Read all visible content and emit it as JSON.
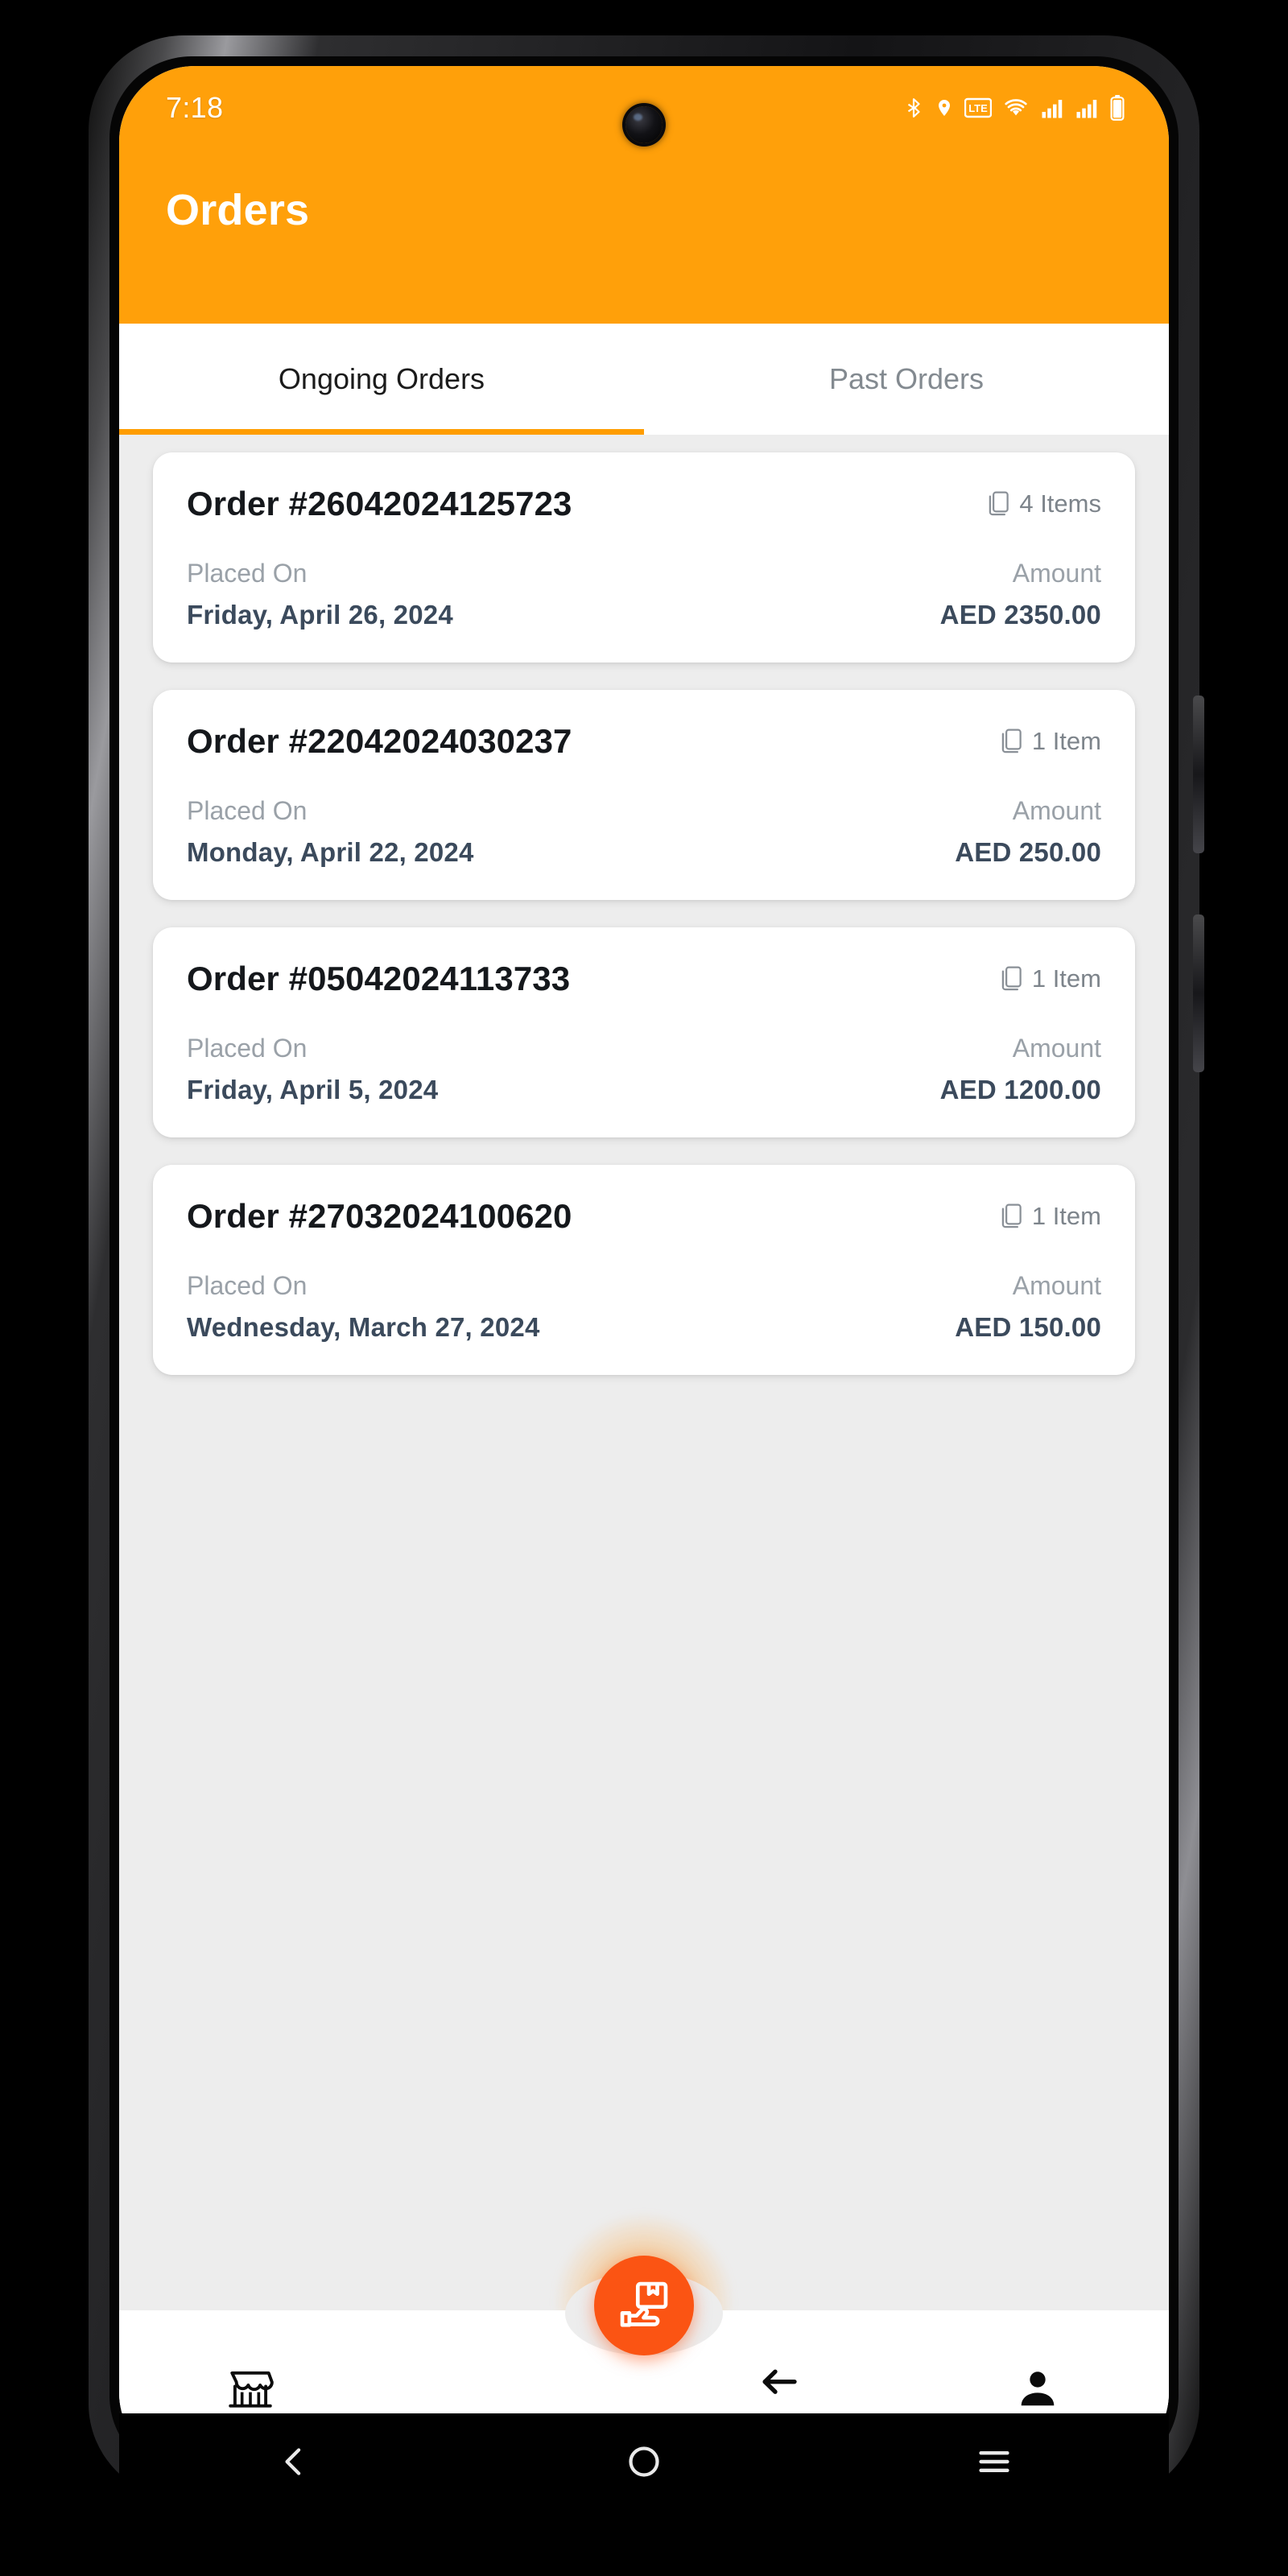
{
  "status_bar": {
    "time": "7:18",
    "icons": [
      "bluetooth-icon",
      "location-icon",
      "lte-icon",
      "wifi-icon",
      "signal-icon-1",
      "signal-icon-2",
      "battery-icon"
    ]
  },
  "app_bar": {
    "title": "Orders",
    "background_color": "#FFA00A"
  },
  "tabs": {
    "active_index": 0,
    "indicator_color": "#FF9D00",
    "items": [
      {
        "label": "Ongoing Orders",
        "active": true
      },
      {
        "label": "Past Orders",
        "active": false
      }
    ]
  },
  "labels": {
    "placed_on": "Placed On",
    "amount": "Amount"
  },
  "orders": [
    {
      "order_no": "Order #26042024125723",
      "items_count": "4 Items",
      "placed_on_label": "Placed On",
      "placed_on": "Friday, April 26, 2024",
      "amount_label": "Amount",
      "amount": "AED 2350.00"
    },
    {
      "order_no": "Order #22042024030237",
      "items_count": "1 Item",
      "placed_on_label": "Placed On",
      "placed_on": "Monday, April 22, 2024",
      "amount_label": "Amount",
      "amount": "AED 250.00"
    },
    {
      "order_no": "Order #05042024113733",
      "items_count": "1 Item",
      "placed_on_label": "Placed On",
      "placed_on": "Friday, April 5, 2024",
      "amount_label": "Amount",
      "amount": "AED 1200.00"
    },
    {
      "order_no": "Order #27032024100620",
      "items_count": "1 Item",
      "placed_on_label": "Placed On",
      "placed_on": "Wednesday, March 27, 2024",
      "amount_label": "Amount",
      "amount": "AED 150.00"
    }
  ],
  "bottom_nav": {
    "fab": {
      "icon": "package-delivery-icon",
      "color": "#FB5413"
    },
    "items": [
      {
        "icon": "store-icon"
      },
      {
        "icon": "back-arrow-icon"
      },
      {
        "icon": "person-icon"
      }
    ]
  },
  "android_nav": {
    "items": [
      "back-icon",
      "home-icon",
      "recents-icon"
    ]
  },
  "colors": {
    "accent_orange": "#FFA00A",
    "fab_orange": "#FB5413",
    "value_text": "#3b4a5c",
    "muted_text": "#9aa1a8",
    "page_bg": "#ededed"
  }
}
